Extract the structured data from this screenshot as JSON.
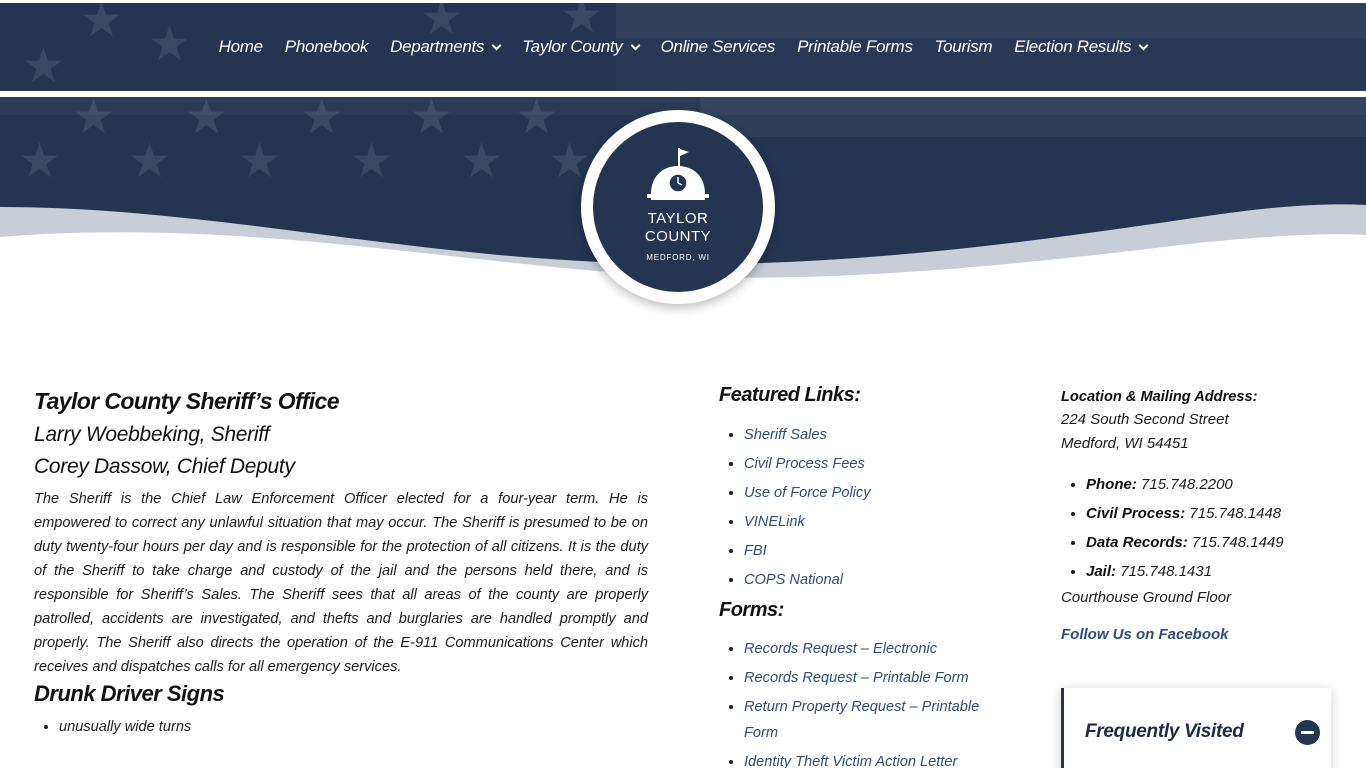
{
  "nav": {
    "items": [
      {
        "label": "Home",
        "dropdown": false
      },
      {
        "label": "Phonebook",
        "dropdown": false
      },
      {
        "label": "Departments",
        "dropdown": true
      },
      {
        "label": "Taylor County",
        "dropdown": true
      },
      {
        "label": "Online Services",
        "dropdown": false
      },
      {
        "label": "Printable Forms",
        "dropdown": false
      },
      {
        "label": "Tourism",
        "dropdown": false
      },
      {
        "label": "Election Results",
        "dropdown": true
      }
    ]
  },
  "logo": {
    "line1": "TAYLOR",
    "line2": "COUNTY",
    "line3": "MEDFORD, WI"
  },
  "main": {
    "title": "Taylor County Sheriff’s Office",
    "sheriff": "Larry Woebbeking, Sheriff",
    "deputy": "Corey Dassow, Chief Deputy",
    "description": "The Sheriff is the Chief Law Enforcement Officer elected for a four-year term. He is empowered to correct any unlawful situation that may occur. The Sheriff is presumed to be on duty twenty-four hours per day and is responsible for the protection of all citizens. It is the duty of the Sheriff to take charge and custody of the jail and the persons held there, and is responsible for Sheriff’s Sales. The Sheriff sees that all areas of the county are properly patrolled, accidents are investigated, and thefts and burglaries are handled promptly and properly. The Sheriff also directs the operation of the E-911 Communications Center which receives and dispatches calls for all emergency services.",
    "drunk_title": "Drunk Driver Signs",
    "drunk_items": [
      "unusually wide turns"
    ]
  },
  "featured": {
    "title": "Featured Links:",
    "links": [
      "Sheriff Sales",
      "Civil Process Fees",
      "Use of Force Policy",
      "VINELink",
      "FBI",
      "COPS National"
    ]
  },
  "forms": {
    "title": "Forms:",
    "links": [
      "Records Request – Electronic",
      "Records Request – Printable Form",
      "Return Property Request – Printable Form",
      "Identity Theft Victim Action Letter"
    ]
  },
  "contact": {
    "address_title": "Location & Mailing Address:",
    "street": "224 South Second Street",
    "city": "Medford, WI 54451",
    "phones": [
      {
        "label": "Phone:",
        "value": "715.748.2200"
      },
      {
        "label": "Civil Process:",
        "value": "715.748.1448"
      },
      {
        "label": "Data Records:",
        "value": "715.748.1449"
      },
      {
        "label": "Jail:",
        "value": "715.748.1431"
      }
    ],
    "floor": "Courthouse Ground Floor",
    "facebook": "Follow Us on Facebook"
  },
  "frequently_visited": {
    "title": "Frequently Visited"
  },
  "colors": {
    "navy": "#243552",
    "link": "#2f4e7a"
  }
}
